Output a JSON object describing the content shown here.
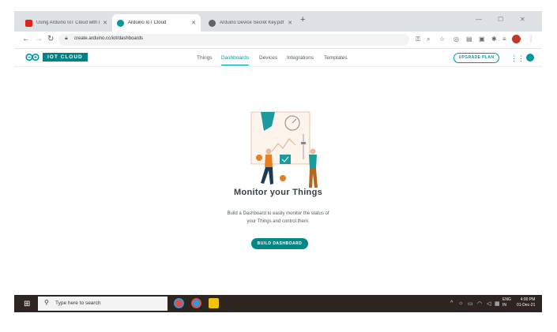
{
  "browser": {
    "tabs": [
      {
        "title": "Using Arduino IoT Cloud with E…",
        "favicon_color": "#e62117"
      },
      {
        "title": "Arduino IoT Cloud",
        "favicon_color": "#00979d"
      },
      {
        "title": "Arduino Device Secret Key.pdf",
        "favicon_color": "#5f6368"
      }
    ],
    "new_tab": "+",
    "url": "create.arduino.cc/iot/dashboards"
  },
  "app": {
    "brand": "IOT CLOUD",
    "nav": [
      {
        "label": "Things",
        "active": false
      },
      {
        "label": "Dashboards",
        "active": true
      },
      {
        "label": "Devices",
        "active": false
      },
      {
        "label": "Integrations",
        "active": false
      },
      {
        "label": "Templates",
        "active": false
      }
    ],
    "upgrade_label": "UPGRADE PLAN",
    "accent": "#00979d"
  },
  "empty_state": {
    "title": "Monitor your Things",
    "description_line1": "Build a Dashboard to easily monitor the status of",
    "description_line2": "your Things and control them.",
    "button_label": "BUILD DASHBOARD"
  },
  "taskbar": {
    "search_placeholder": "Type here to search",
    "language_line1": "ENG",
    "language_line2": "IN",
    "time": "4:00 PM",
    "date": "01-Dec-21"
  }
}
